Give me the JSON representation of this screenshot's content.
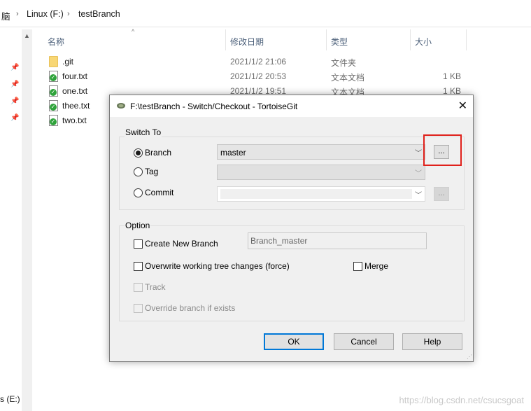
{
  "breadcrumb": {
    "item1": "脑",
    "item2": "Linux (F:)",
    "item3": "testBranch"
  },
  "nav": {
    "drive": "s (E:)"
  },
  "columns": {
    "name": "名称",
    "date": "修改日期",
    "type": "类型",
    "size": "大小"
  },
  "files": [
    {
      "name": ".git",
      "date": "2021/1/2 21:06",
      "type": "文件夹",
      "size": "",
      "icon": "folder-icon"
    },
    {
      "name": "four.txt",
      "date": "2021/1/2 20:53",
      "type": "文本文档",
      "size": "1 KB",
      "icon": "text-file-git-icon"
    },
    {
      "name": "one.txt",
      "date": "2021/1/2 19:51",
      "type": "文本文档",
      "size": "1 KB",
      "icon": "text-file-git-icon"
    },
    {
      "name": "thee.txt",
      "date": "",
      "type": "",
      "size": "",
      "icon": "text-file-git-icon"
    },
    {
      "name": "two.txt",
      "date": "",
      "type": "",
      "size": "",
      "icon": "text-file-git-icon"
    }
  ],
  "dialog": {
    "title": "F:\\testBranch - Switch/Checkout - TortoiseGit",
    "switch_to": {
      "label": "Switch To",
      "branch_label": "Branch",
      "branch_value": "master",
      "tag_label": "Tag",
      "commit_label": "Commit",
      "selected": "Branch",
      "browse_label": "..."
    },
    "option": {
      "label": "Option",
      "create_new_branch": "Create New Branch",
      "new_branch_name": "Branch_master",
      "overwrite": "Overwrite working tree changes (force)",
      "merge": "Merge",
      "track": "Track",
      "override": "Override branch if exists"
    },
    "buttons": {
      "ok": "OK",
      "cancel": "Cancel",
      "help": "Help"
    }
  },
  "watermark": "https://blog.csdn.net/csucsgoat",
  "colors": {
    "highlight": "#e0211b",
    "default_button": "#0078d7"
  }
}
